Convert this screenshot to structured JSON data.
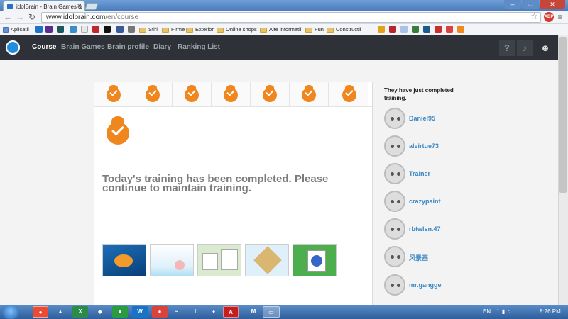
{
  "browser": {
    "tab_title": "idolBrain - Brain Games &",
    "url_host": "www.idolbrain.com",
    "url_path": "/en/course",
    "bookmarks": [
      "Aplicații",
      "Stiri",
      "Firme",
      "Exterior",
      "Online shops",
      "Alte informatii",
      "Fun",
      "Constructii"
    ]
  },
  "site": {
    "nav": [
      "Course",
      "Brain Games",
      "Brain profile",
      "Diary",
      "Ranking List"
    ],
    "help_label": "?",
    "message": "Today's training has been completed. Please continue to maintain training.",
    "sidebar_title": "They have just completed training.",
    "users": [
      "Daniel95",
      "alvirtue73",
      "Trainer",
      "crazypaint",
      "rbtwlsn.47",
      "风景画",
      "mr.gangge"
    ],
    "completed_steps": 7
  },
  "taskbar": {
    "language": "EN",
    "time": "8:26 PM"
  },
  "colors": {
    "accent": "#f0861e",
    "header": "#2e3238",
    "link": "#3b86c4"
  }
}
